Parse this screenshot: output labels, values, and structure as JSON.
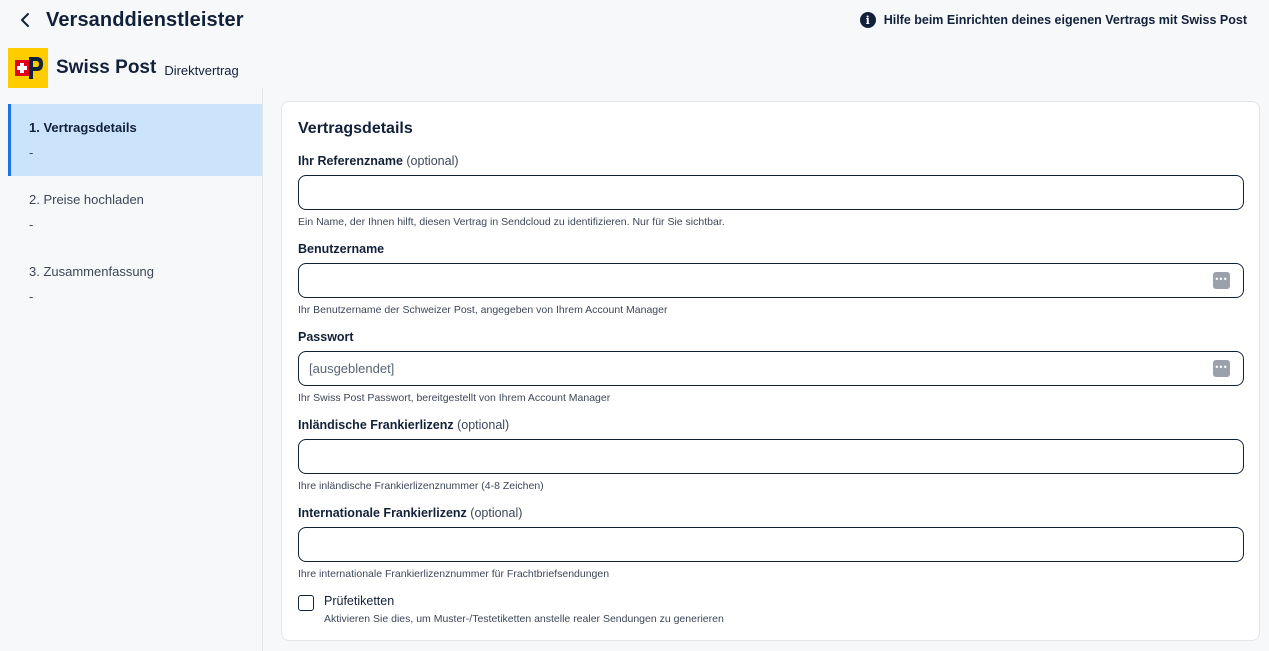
{
  "header": {
    "title": "Versanddienstleister",
    "help_text": "Hilfe beim Einrichten deines eigenen Vertrags mit Swiss Post"
  },
  "carrier": {
    "name": "Swiss Post",
    "subtitle": "Direktvertrag",
    "logo_color": "#ffcc00",
    "logo_letter": "P"
  },
  "sidebar": {
    "steps": [
      {
        "label": "1. Vertragsdetails",
        "sub": "-",
        "active": true
      },
      {
        "label": "2. Preise hochladen",
        "sub": "-",
        "active": false
      },
      {
        "label": "3. Zusammenfassung",
        "sub": "-",
        "active": false
      }
    ]
  },
  "form": {
    "title": "Vertragsdetails",
    "fields": [
      {
        "label": "Ihr Referenzname",
        "optional": "(optional)",
        "value": "",
        "placeholder": "",
        "hint": "Ein Name, der Ihnen hilft, diesen Vertrag in Sendcloud zu identifizieren. Nur für Sie sichtbar."
      },
      {
        "label": "Benutzername",
        "optional": "",
        "value": "",
        "placeholder": "",
        "hint": "Ihr Benutzername der Schweizer Post, angegeben von Ihrem Account Manager"
      },
      {
        "label": "Passwort",
        "optional": "",
        "value": "",
        "placeholder": "[ausgeblendet]",
        "hint": "Ihr Swiss Post Passwort, bereitgestellt von Ihrem Account Manager"
      },
      {
        "label": "Inländische Frankierlizenz",
        "optional": "(optional)",
        "value": "",
        "placeholder": "",
        "hint": "Ihre inländische Frankierlizenznummer (4-8 Zeichen)"
      },
      {
        "label": "Internationale Frankierlizenz",
        "optional": "(optional)",
        "value": "",
        "placeholder": "",
        "hint": "Ihre internationale Frankierlizenznummer für Frachtbriefsendungen"
      }
    ],
    "test_labels": {
      "label": "Prüfetiketten",
      "hint": "Aktivieren Sie dies, um Muster-/Testetiketten anstelle realer Sendungen zu generieren",
      "checked": false
    }
  },
  "colors": {
    "accent": "#1a73e8",
    "active_step_bg": "#cce4fb",
    "text_primary": "#12213a"
  }
}
